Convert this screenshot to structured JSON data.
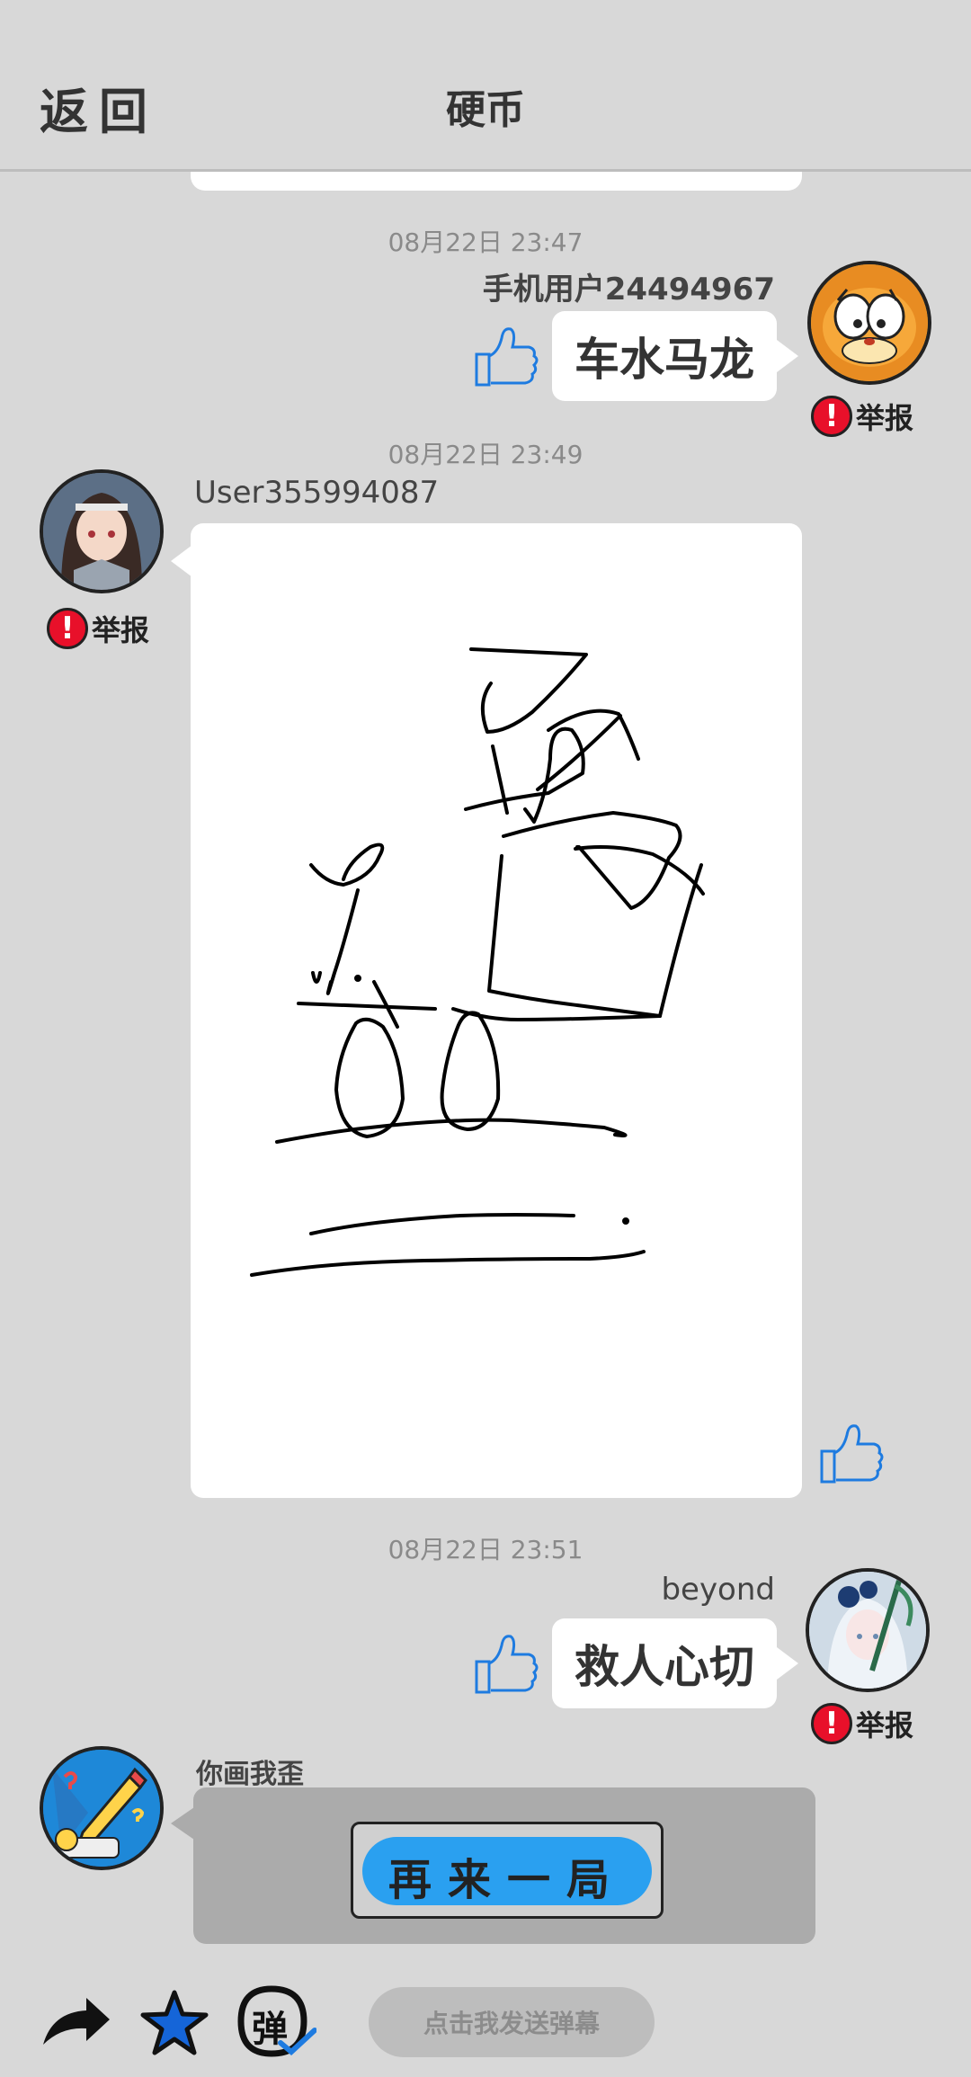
{
  "header": {
    "back_label": "返回",
    "title": "硬币"
  },
  "report_label": "举报",
  "report_mark": "!",
  "messages": [
    {
      "time": "08月22日  23:47",
      "user": "手机用户24494967",
      "text": "车水马龙",
      "side": "right"
    },
    {
      "time": "08月22日  23:49",
      "user": "User355994087",
      "type": "drawing",
      "side": "left"
    },
    {
      "time": "08月22日  23:51",
      "user": "beyond",
      "text": "救人心切",
      "side": "right"
    }
  ],
  "system": {
    "user": "你画我歪",
    "button_label": "再来一局"
  },
  "bottom": {
    "danmu_icon_label": "弹",
    "danmu_placeholder": "点击我发送弹幕"
  },
  "colors": {
    "background": "#d8d8d8",
    "report_red": "#e8102a",
    "like_blue": "#1e7be0",
    "star_blue": "#1565d8",
    "again_blue": "#2aa0f0"
  },
  "icons": [
    "share-arrow-icon",
    "star-icon",
    "danmu-icon",
    "thumbs-up-icon",
    "report-icon"
  ]
}
